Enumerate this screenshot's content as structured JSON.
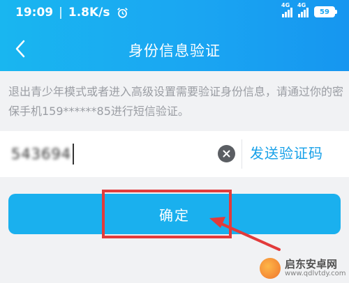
{
  "status": {
    "time": "19:09",
    "separator": "|",
    "speed": "1.8K/s",
    "signal1_label": "4G",
    "signal2_label": "4G",
    "battery": "59"
  },
  "header": {
    "title": "身份信息验证"
  },
  "info": {
    "text": "退出青少年模式或者进入高级设置需要验证身份信息，请通过你的密保手机159******85进行短信验证。"
  },
  "code_field": {
    "value": "543694"
  },
  "buttons": {
    "send_code": "发送验证码",
    "confirm": "确定"
  },
  "watermark": {
    "title": "启东安卓网",
    "url": "www.qdlvtdy.com"
  },
  "colors": {
    "header": "#1aa6f2",
    "button": "#1ab0ee",
    "link": "#16a0e8",
    "highlight": "#e23b3b"
  }
}
